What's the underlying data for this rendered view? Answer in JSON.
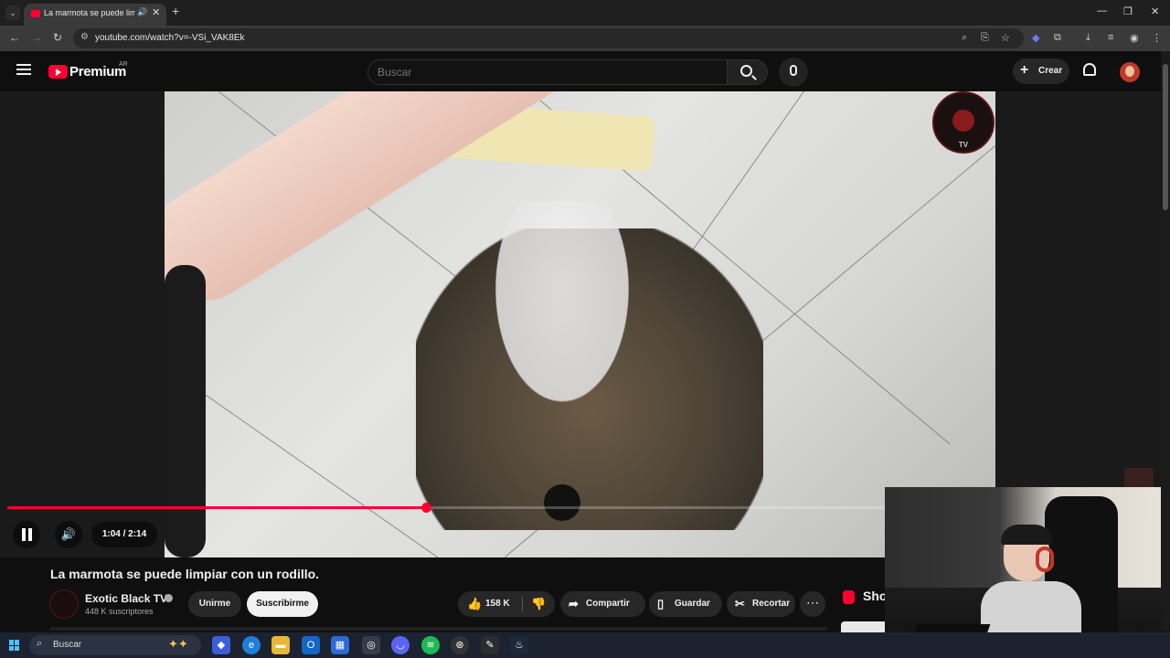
{
  "browser": {
    "tab_title": "La marmota se puede limpi",
    "tab_audio_icon": "speaker-icon",
    "url": "youtube.com/watch?v=-VSi_VAK8Ek",
    "window_controls": [
      "minimize",
      "restore",
      "close"
    ]
  },
  "header": {
    "brand": "Premium",
    "country": "AR",
    "search_placeholder": "Buscar",
    "create_label": "Crear"
  },
  "player": {
    "time_display": "1:04 / 2:14",
    "progress_fraction": 0.4776,
    "watermark": "TV",
    "colors": {
      "progress": "#ff0033"
    }
  },
  "video": {
    "title": "La marmota se puede limpiar con un rodillo.",
    "channel_name": "Exotic Black TV",
    "subscribers": "448 K suscriptores",
    "join_label": "Unirme",
    "subscribe_label": "Suscribirme",
    "likes": "158 K",
    "share_label": "Compartir",
    "save_label": "Guardar",
    "clip_label": "Recortar",
    "shorts_label": "Sho"
  },
  "taskbar": {
    "search_label": "Buscar",
    "apps": [
      "copilot-icon",
      "edge-icon",
      "file-explorer-icon",
      "outlook-icon",
      "store-icon",
      "chrome-icon",
      "discord-icon",
      "spotify-icon",
      "steam-logo-icon",
      "notepad-icon",
      "steam-icon"
    ]
  }
}
